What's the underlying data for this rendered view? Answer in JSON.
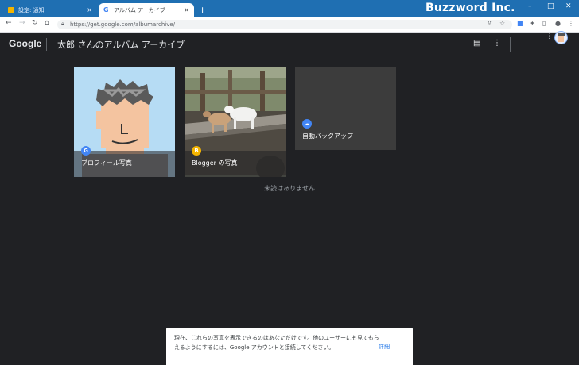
{
  "browser": {
    "tabs": [
      {
        "title": "設定: 通知",
        "active": false
      },
      {
        "title": "アルバム アーカイブ",
        "active": true
      }
    ],
    "new_tab": "+",
    "close": "×",
    "url": "https://get.google.com/albumarchive/",
    "brand": "Buzzword Inc.",
    "window": {
      "minimize": "–",
      "maximize": "□",
      "close": "✕"
    }
  },
  "appbar": {
    "logo": "Google",
    "title": "太郎 さんのアルバム アーカイブ"
  },
  "albums": [
    {
      "label": "プロフィール写真",
      "badge": "G",
      "badge_color": "#4285f4",
      "icon": "google-icon"
    },
    {
      "label": "Blogger の写真",
      "badge": "B",
      "badge_color": "#f4b400",
      "icon": "blogger-icon"
    },
    {
      "label": "自動バックアップ",
      "badge": "☁",
      "badge_color": "#4285f4",
      "icon": "cloud-backup-icon"
    }
  ],
  "empty_message": "未読はありません",
  "notice": {
    "text": "現在、これらの写真を表示できるのはあなただけです。他のユーザーにも見てもらえるようにするには、Google アカウントと接続してください。",
    "link": "詳細"
  },
  "colors": {
    "titlebar": "#1f6fb2",
    "page_bg": "#202124",
    "link": "#1a73e8"
  }
}
